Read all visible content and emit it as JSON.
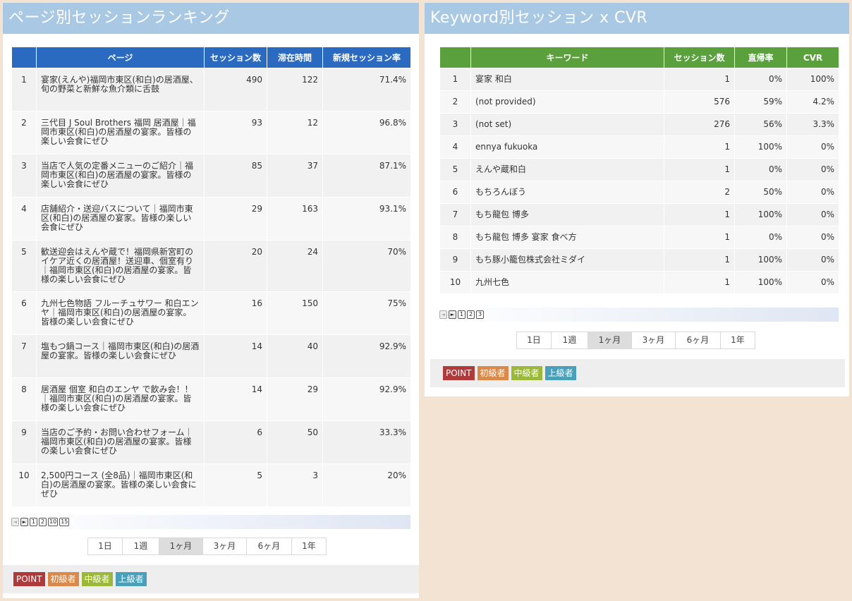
{
  "left": {
    "title": "ページ別セッションランキング",
    "headers": [
      "",
      "ページ",
      "セッション数",
      "滞在時間",
      "新規セッション率"
    ],
    "rows": [
      {
        "idx": "1",
        "page": "宴家(えんや)福岡市東区(和白)の居酒屋、旬の野菜と新鮮な魚介類に舌鼓",
        "sessions": "490",
        "time": "122",
        "rate": "71.4%"
      },
      {
        "idx": "2",
        "page": "三代目 J Soul Brothers 福岡 居酒屋｜福岡市東区(和白)の居酒屋の宴家。皆様の楽しい会食にぜひ",
        "sessions": "93",
        "time": "12",
        "rate": "96.8%"
      },
      {
        "idx": "3",
        "page": "当店で人気の定番メニューのご紹介｜福岡市東区(和白)の居酒屋の宴家。皆様の楽しい会食にぜひ",
        "sessions": "85",
        "time": "37",
        "rate": "87.1%"
      },
      {
        "idx": "4",
        "page": "店舗紹介・送迎バスについて｜福岡市東区(和白)の居酒屋の宴家。皆様の楽しい会食にぜひ",
        "sessions": "29",
        "time": "163",
        "rate": "93.1%"
      },
      {
        "idx": "5",
        "page": "歓送迎会はえんや蔵で！福岡県新宮町のイケア近くの居酒屋！送迎車、個室有り｜福岡市東区(和白)の居酒屋の宴家。皆様の楽しい会食にぜひ",
        "sessions": "20",
        "time": "24",
        "rate": "70%"
      },
      {
        "idx": "6",
        "page": "九州七色物語 フルーチュサワー 和白エンヤ｜福岡市東区(和白)の居酒屋の宴家。皆様の楽しい会食にぜひ",
        "sessions": "16",
        "time": "150",
        "rate": "75%"
      },
      {
        "idx": "7",
        "page": "塩もつ鍋コース｜福岡市東区(和白)の居酒屋の宴家。皆様の楽しい会食にぜひ",
        "sessions": "14",
        "time": "40",
        "rate": "92.9%"
      },
      {
        "idx": "8",
        "page": "居酒屋 個室 和白のエンヤ で飲み会！！｜福岡市東区(和白)の居酒屋の宴家。皆様の楽しい会食にぜひ",
        "sessions": "14",
        "time": "29",
        "rate": "92.9%"
      },
      {
        "idx": "9",
        "page": "当店のご予約・お問い合わせフォーム｜福岡市東区(和白)の居酒屋の宴家。皆様の楽しい会食にぜひ",
        "sessions": "6",
        "time": "50",
        "rate": "33.3%"
      },
      {
        "idx": "10",
        "page": "2,500円コース (全8品)｜福岡市東区(和白)の居酒屋の宴家。皆様の楽しい会食にぜひ",
        "sessions": "5",
        "time": "3",
        "rate": "20%"
      }
    ],
    "pager": {
      "prev": "◄",
      "next": "►",
      "pages": [
        "1",
        "2",
        "10",
        "15"
      ]
    },
    "ranges": [
      "1日",
      "1週",
      "1ヶ月",
      "3ヶ月",
      "6ヶ月",
      "1年"
    ],
    "active_range": "1ヶ月"
  },
  "right": {
    "title": "Keyword別セッション x CVR",
    "headers": [
      "",
      "キーワード",
      "セッション数",
      "直帰率",
      "CVR"
    ],
    "rows": [
      {
        "idx": "1",
        "kw": "宴家 和白",
        "sessions": "1",
        "bounce": "0%",
        "cvr": "100%"
      },
      {
        "idx": "2",
        "kw": "(not provided)",
        "sessions": "576",
        "bounce": "59%",
        "cvr": "4.2%"
      },
      {
        "idx": "3",
        "kw": "(not set)",
        "sessions": "276",
        "bounce": "56%",
        "cvr": "3.3%"
      },
      {
        "idx": "4",
        "kw": "ennya fukuoka",
        "sessions": "1",
        "bounce": "100%",
        "cvr": "0%"
      },
      {
        "idx": "5",
        "kw": "えんや蔵和白",
        "sessions": "1",
        "bounce": "0%",
        "cvr": "0%"
      },
      {
        "idx": "6",
        "kw": "もちろんぼう",
        "sessions": "2",
        "bounce": "50%",
        "cvr": "0%"
      },
      {
        "idx": "7",
        "kw": "もち龍包 博多",
        "sessions": "1",
        "bounce": "100%",
        "cvr": "0%"
      },
      {
        "idx": "8",
        "kw": "もち龍包 博多 宴家 食べ方",
        "sessions": "1",
        "bounce": "0%",
        "cvr": "0%"
      },
      {
        "idx": "9",
        "kw": "もち豚小籠包株式会社ミダイ",
        "sessions": "1",
        "bounce": "100%",
        "cvr": "0%"
      },
      {
        "idx": "10",
        "kw": "九州七色",
        "sessions": "1",
        "bounce": "100%",
        "cvr": "0%"
      }
    ],
    "pager": {
      "prev": "◄",
      "next": "►",
      "pages": [
        "1",
        "2",
        "3"
      ]
    },
    "ranges": [
      "1日",
      "1週",
      "1ヶ月",
      "3ヶ月",
      "6ヶ月",
      "1年"
    ],
    "active_range": "1ヶ月"
  },
  "tags": {
    "point": "POINT",
    "beginner": "初級者",
    "middle": "中級者",
    "advanced": "上級者"
  },
  "colors": {
    "title_bar": "#a9c8e3",
    "page_table_header": "#2a6ac0",
    "keyword_table_header": "#5aa03c",
    "tag_point": "#b03a3a",
    "tag_beginner": "#d98a4a",
    "tag_middle": "#9cb83a",
    "tag_advanced": "#4aa0b8"
  }
}
